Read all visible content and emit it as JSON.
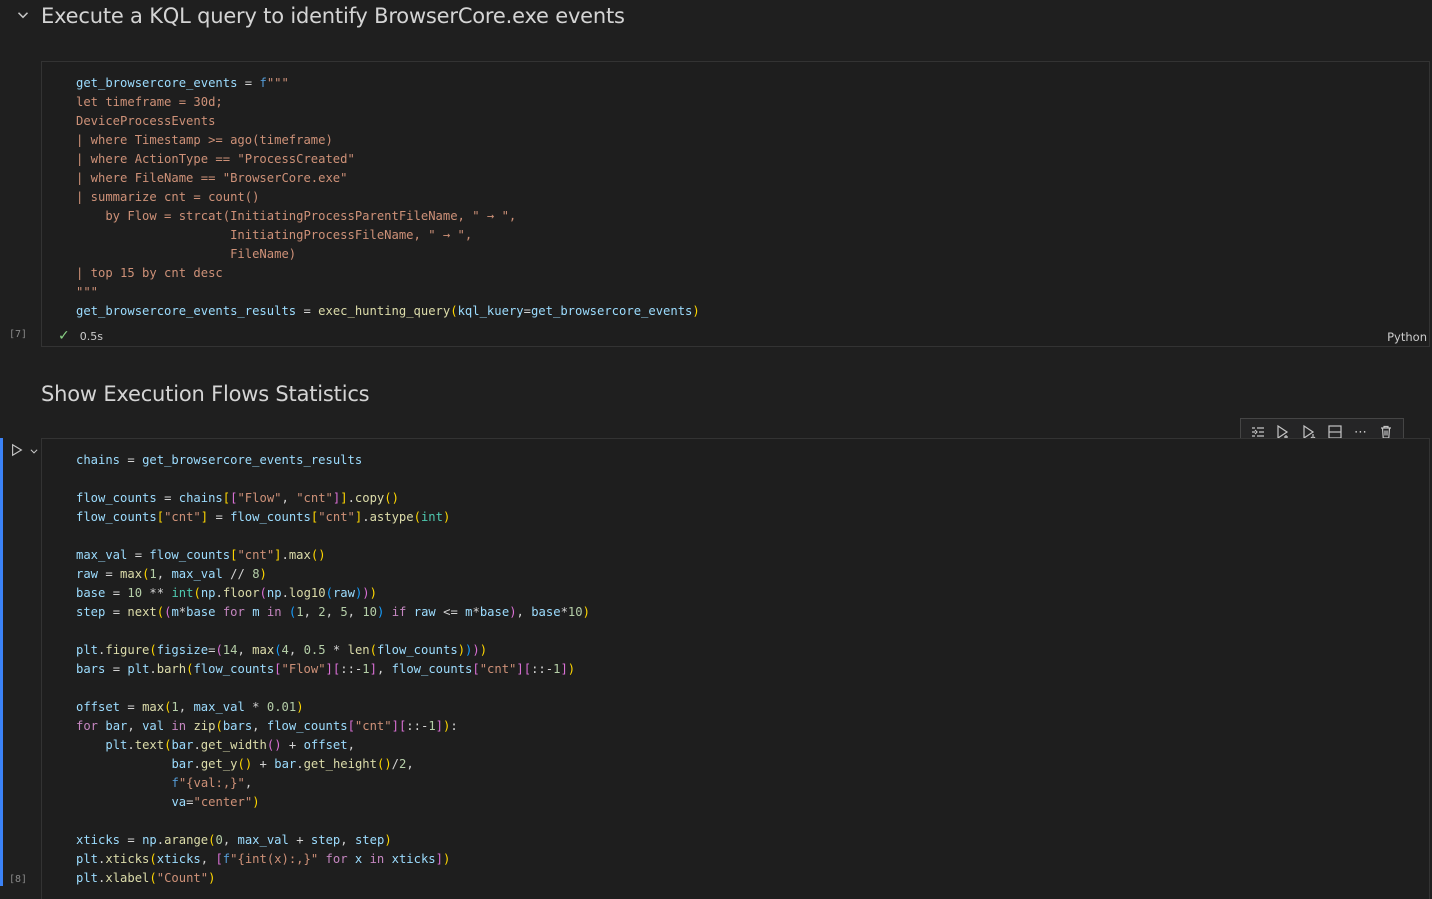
{
  "cells": {
    "md1": {
      "title": "Execute a KQL query to identify BrowserCore.exe events"
    },
    "md2": {
      "title": "Show Execution Flows Statistics"
    },
    "code1": {
      "exec_count": "[7]",
      "duration": "0.5s",
      "language": "Python"
    },
    "code2": {
      "exec_count": "[8]"
    }
  },
  "toolbar": {
    "icons": [
      "execute-above-icon",
      "execute-cell-and-below-icon",
      "execute-and-below-icon",
      "split-cell-icon",
      "more-actions-icon",
      "delete-cell-icon"
    ]
  },
  "code1_lines": [
    "get_browsercore_events = f\"\"\"",
    "let timeframe = 30d;",
    "DeviceProcessEvents",
    "| where Timestamp >= ago(timeframe)",
    "| where ActionType == \"ProcessCreated\"",
    "| where FileName == \"BrowserCore.exe\"",
    "| summarize cnt = count()",
    "    by Flow = strcat(InitiatingProcessParentFileName, \" → \",",
    "                     InitiatingProcessFileName, \" → \",",
    "                     FileName)",
    "| top 15 by cnt desc",
    "\"\"\"",
    "get_browsercore_events_results = exec_hunting_query(kql_kuery=get_browsercore_events)"
  ],
  "code2_lines": [
    "chains = get_browsercore_events_results",
    "",
    "flow_counts = chains[[\"Flow\", \"cnt\"]].copy()",
    "flow_counts[\"cnt\"] = flow_counts[\"cnt\"].astype(int)",
    "",
    "max_val = flow_counts[\"cnt\"].max()",
    "raw = max(1, max_val // 8)",
    "base = 10 ** int(np.floor(np.log10(raw)))",
    "step = next((m*base for m in (1, 2, 5, 10) if raw <= m*base), base*10)",
    "",
    "plt.figure(figsize=(14, max(4, 0.5 * len(flow_counts))))",
    "bars = plt.barh(flow_counts[\"Flow\"][::-1], flow_counts[\"cnt\"][::-1])",
    "",
    "offset = max(1, max_val * 0.01)",
    "for bar, val in zip(bars, flow_counts[\"cnt\"][::-1]):",
    "    plt.text(bar.get_width() + offset,",
    "             bar.get_y() + bar.get_height()/2,",
    "             f\"{val:,}\",",
    "             va=\"center\")",
    "",
    "xticks = np.arange(0, max_val + step, step)",
    "plt.xticks(xticks, [f\"{int(x):,}\" for x in xticks])",
    "plt.xlabel(\"Count\")"
  ]
}
